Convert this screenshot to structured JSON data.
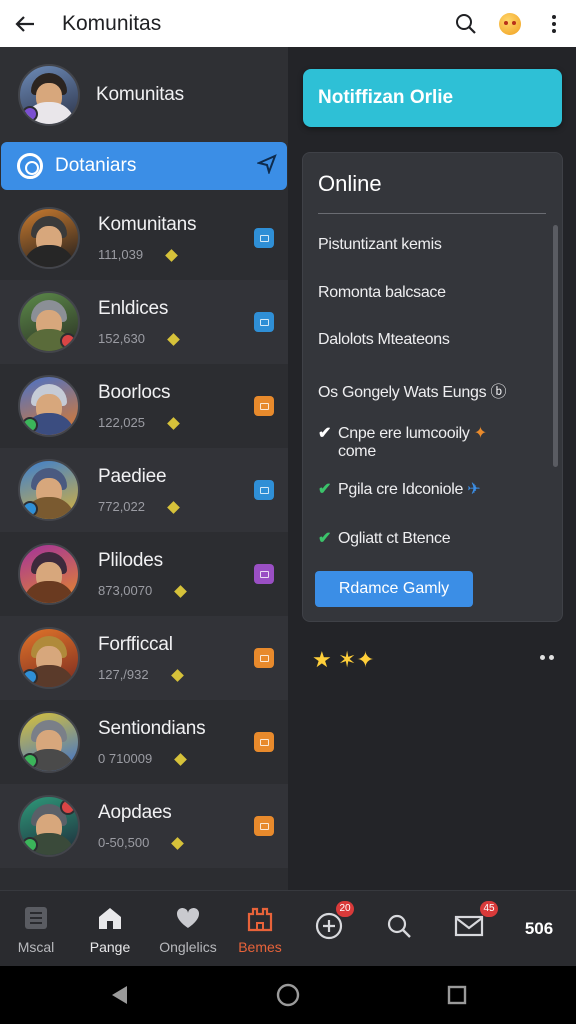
{
  "appbar": {
    "title": "Komunitas",
    "back_icon": "arrow-left-icon",
    "search_icon": "search-icon",
    "emoji_icon": "emoji-face-icon",
    "menu_icon": "more-vert-icon"
  },
  "left": {
    "top_card": {
      "name": "Komunitas"
    },
    "selected": {
      "label": "Dotaniars",
      "chat_icon": "chat-icon",
      "send_icon": "send-icon"
    },
    "rows": [
      {
        "name": "Komunitans",
        "count": "111,039",
        "tag_color": "#2f8fd6"
      },
      {
        "name": "Enldices",
        "count": "152,630",
        "tag_color": "#2f8fd6"
      },
      {
        "name": "Boorlocs",
        "count": "122,025",
        "tag_color": "#e88a2c"
      },
      {
        "name": "Paediee",
        "count": "772,022",
        "tag_color": "#2f8fd6"
      },
      {
        "name": "Plilodes",
        "count": "873,0070",
        "tag_color": "#9a4fc4"
      },
      {
        "name": "Forfficcal",
        "count": "127,/932",
        "tag_color": "#e88a2c"
      },
      {
        "name": "Sentiondians",
        "count": "0 710009",
        "tag_color": "#e88a2c"
      },
      {
        "name": "Aopdaes",
        "count": "0-50,500",
        "tag_color": "#e88a2c"
      }
    ]
  },
  "right": {
    "notify_label": "Notiffizan Orlie",
    "panel_title": "Online",
    "items": [
      {
        "check": "",
        "text": "Pistuntizant kemis"
      },
      {
        "check": "",
        "text": "Romonta balcsace"
      },
      {
        "check": "",
        "text": "Dalolots Mteateons"
      },
      {
        "check": "",
        "text": "Os Gongely Wats Eungs ⓑ"
      },
      {
        "check": "✔",
        "text": "Cnpe ere lumcooily",
        "text2": "come"
      },
      {
        "check": "✔",
        "text": "Pgila cre Idconiole"
      },
      {
        "check": "✔",
        "text": "Ogliatt ct Btence"
      }
    ],
    "action_button": "Rdamce Gamly",
    "stars": "★ ✶✦"
  },
  "bottomnav": {
    "items": [
      {
        "label": "Mscal",
        "icon": "list-icon"
      },
      {
        "label": "Pange",
        "icon": "home-icon"
      },
      {
        "label": "Onglelics",
        "icon": "heart-icon"
      },
      {
        "label": "Bemes",
        "icon": "castle-icon",
        "active": true
      },
      {
        "label": "",
        "icon": "add-circle-icon",
        "badge": "20"
      },
      {
        "label": "",
        "icon": "search-icon"
      },
      {
        "label": "",
        "icon": "mail-icon",
        "badge": "45"
      },
      {
        "label": "506",
        "icon": ""
      }
    ]
  },
  "colors": {
    "accent": "#3b8ee6",
    "cyan": "#2ec0d6",
    "active_nav": "#e8633a",
    "background": "#232428"
  }
}
